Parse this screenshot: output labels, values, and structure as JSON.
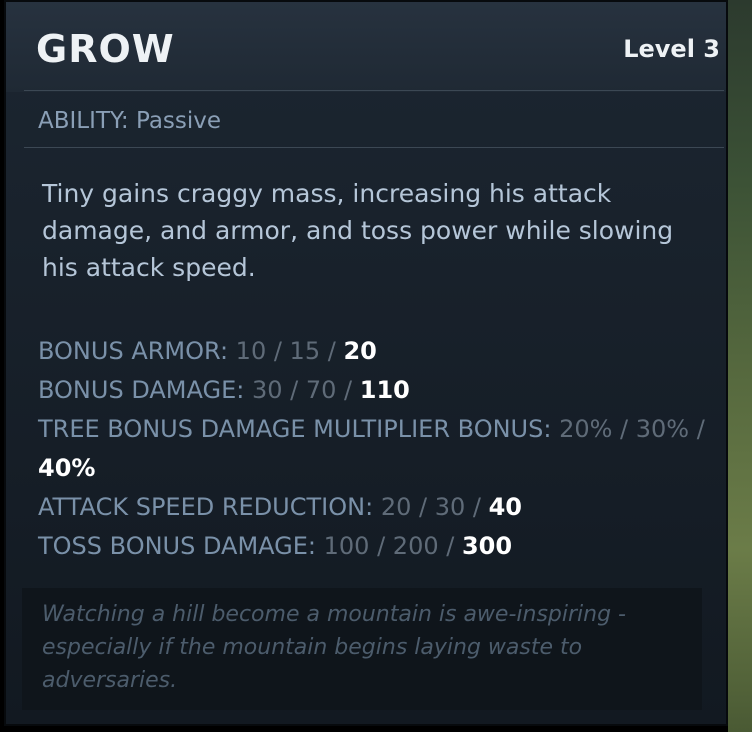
{
  "ability": {
    "name": "GROW",
    "level": "Level 3",
    "type": "ABILITY: Passive",
    "description": "Tiny gains craggy mass, increasing his attack damage, and armor, and toss power while slowing his attack speed."
  },
  "stats": [
    {
      "label": "BONUS ARMOR:",
      "values": "10 / 15 /",
      "current": "20"
    },
    {
      "label": "BONUS DAMAGE:",
      "values": "30 / 70 /",
      "current": "110"
    },
    {
      "label": "TREE BONUS DAMAGE MULTIPLIER BONUS:",
      "values": "20% / 30% /",
      "current": "40%"
    },
    {
      "label": "ATTACK SPEED REDUCTION:",
      "values": "20 / 30 /",
      "current": "40"
    },
    {
      "label": "TOSS BONUS DAMAGE:",
      "values": "100 / 200 /",
      "current": "300"
    }
  ],
  "lore": "Watching a hill become a mountain is awe-inspiring - especially if the mountain begins laying waste to adversaries."
}
